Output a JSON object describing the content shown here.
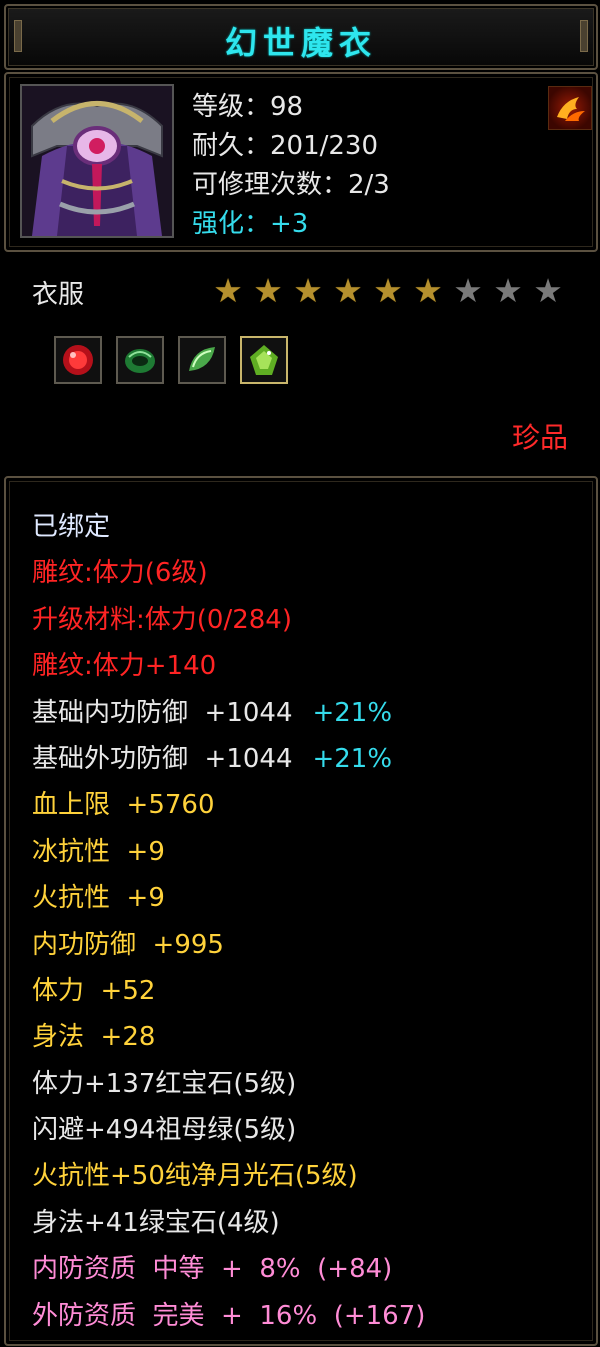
{
  "item": {
    "name": "幻世魔衣",
    "level_line": "等级：98",
    "durability_line": "耐久：201/230",
    "repair_line": "可修理次数：2/3",
    "enhance_line": "强化：+3",
    "type": "衣服",
    "stars_total": 9,
    "stars_filled": 6,
    "rarity": "珍品",
    "gems": [
      {
        "icon": "ruby-gem-icon",
        "color": "#d61e1e"
      },
      {
        "icon": "emerald-ring-icon",
        "color": "#2ea84a"
      },
      {
        "icon": "moonstone-gem-icon",
        "color": "#7fd06a"
      },
      {
        "icon": "green-gem-icon",
        "color": "#8ad83a"
      }
    ]
  },
  "attributes": {
    "bound": "已绑定",
    "lines": [
      {
        "text": "雕纹:体力(6级)",
        "color": "red"
      },
      {
        "text": "升级材料:体力(0/284)",
        "color": "red"
      },
      {
        "text": "雕纹:体力+140",
        "color": "red"
      },
      {
        "text": "基础内功防御  +1044",
        "extra": "+21%",
        "color": "white"
      },
      {
        "text": "基础外功防御  +1044",
        "extra": "+21%",
        "color": "white"
      },
      {
        "text": "血上限  +5760",
        "color": "yellow"
      },
      {
        "text": "冰抗性  +9",
        "color": "yellow"
      },
      {
        "text": "火抗性  +9",
        "color": "yellow"
      },
      {
        "text": "内功防御  +995",
        "color": "yellow"
      },
      {
        "text": "体力  +52",
        "color": "yellow"
      },
      {
        "text": "身法  +28",
        "color": "yellow"
      },
      {
        "text": "体力+137红宝石(5级)",
        "color": "white"
      },
      {
        "text": "闪避+494祖母绿(5级)",
        "color": "white"
      },
      {
        "text": "火抗性+50纯净月光石(5级)",
        "color": "yellow"
      },
      {
        "text": "身法+41绿宝石(4级)",
        "color": "white"
      },
      {
        "text": "内防资质  中等  +  8%  (+84)",
        "color": "pink"
      },
      {
        "text": "外防资质  完美  +  16%  (+167)",
        "color": "pink"
      }
    ]
  },
  "colors": {
    "title": "#2ee6ee",
    "cyan": "#35dcec",
    "red": "#ff2424",
    "yellow": "#ffd23b",
    "pink": "#ff8cd6",
    "gold_star": "#b5902e",
    "grey_star": "#7a7a7a",
    "frame": "#5b5140"
  }
}
